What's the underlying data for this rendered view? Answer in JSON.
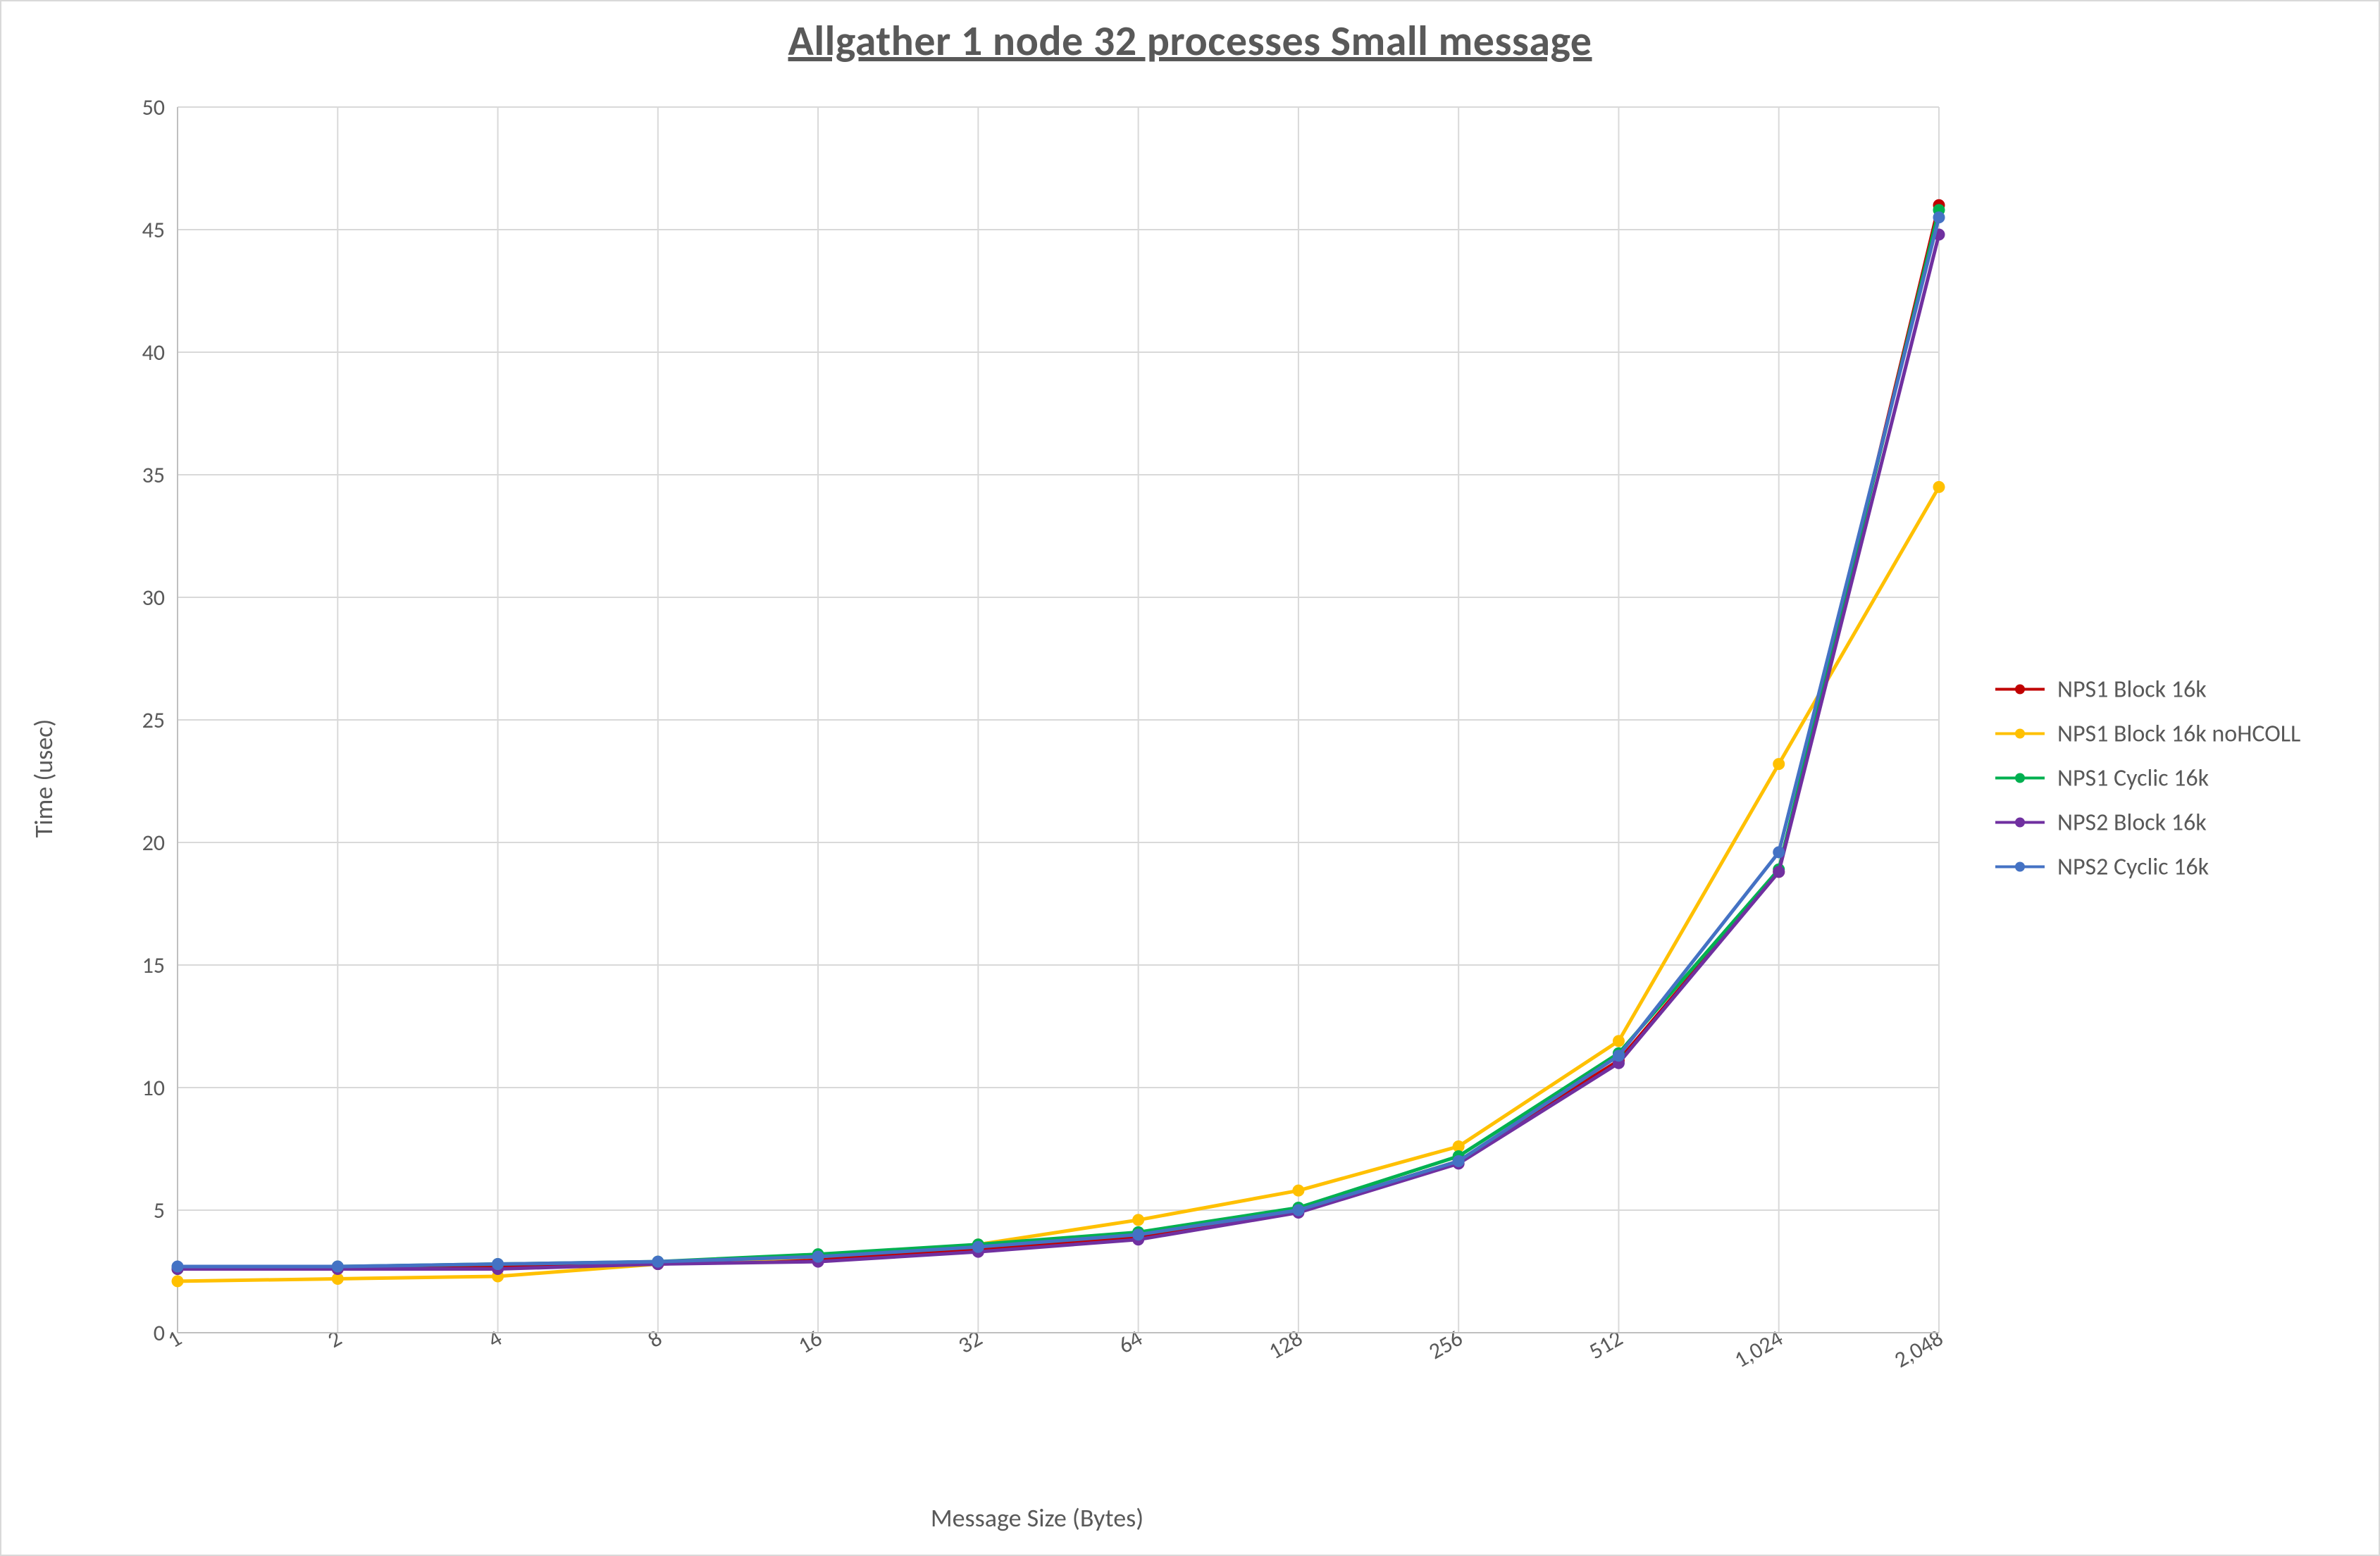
{
  "title": "Allgather 1 node 32 processes Small message",
  "xlabel": "Message Size (Bytes)",
  "ylabel": "Time (usec)",
  "chart_data": {
    "type": "line",
    "xlabel": "Message Size (Bytes)",
    "ylabel": "Time (usec)",
    "title": "Allgather 1 node 32 processes Small message",
    "ylim": [
      0,
      50
    ],
    "y_ticks": [
      0,
      5,
      10,
      15,
      20,
      25,
      30,
      35,
      40,
      45,
      50
    ],
    "categories": [
      1,
      2,
      4,
      8,
      16,
      32,
      64,
      128,
      256,
      512,
      1024,
      2048
    ],
    "x_tick_labels": [
      "1",
      "2",
      "4",
      "8",
      "16",
      "32",
      "64",
      "128",
      "256",
      "512",
      "1,024",
      "2,048"
    ],
    "legend_position": "right",
    "grid": true,
    "series": [
      {
        "name": "NPS1 Block 16k",
        "color": "#C00000",
        "values": [
          2.6,
          2.6,
          2.7,
          2.8,
          3.0,
          3.4,
          3.9,
          5.0,
          7.0,
          11.1,
          18.8,
          46.0
        ]
      },
      {
        "name": "NPS1 Block 16k noHCOLL",
        "color": "#FFC000",
        "values": [
          2.1,
          2.2,
          2.3,
          2.8,
          3.1,
          3.6,
          4.6,
          5.8,
          7.6,
          11.9,
          23.2,
          34.5
        ]
      },
      {
        "name": "NPS1 Cyclic 16k",
        "color": "#00B050",
        "values": [
          2.6,
          2.7,
          2.8,
          2.9,
          3.2,
          3.6,
          4.1,
          5.1,
          7.2,
          11.4,
          18.9,
          45.8
        ]
      },
      {
        "name": "NPS2 Block 16k",
        "color": "#7030A0",
        "values": [
          2.6,
          2.6,
          2.6,
          2.8,
          2.9,
          3.3,
          3.8,
          4.9,
          6.9,
          11.0,
          18.8,
          44.8
        ]
      },
      {
        "name": "NPS2 Cyclic 16k",
        "color": "#4472C4",
        "values": [
          2.7,
          2.7,
          2.8,
          2.9,
          3.1,
          3.5,
          4.0,
          5.0,
          7.0,
          11.3,
          19.6,
          45.5
        ]
      }
    ]
  }
}
